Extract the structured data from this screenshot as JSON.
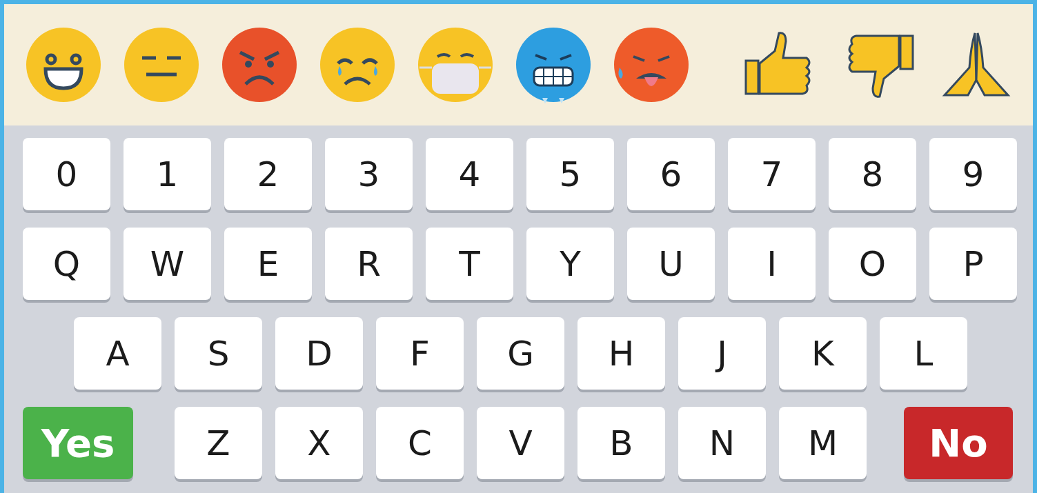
{
  "key_rows": [
    [
      {
        "label": "0",
        "kind": "char"
      },
      {
        "label": "1",
        "kind": "char"
      },
      {
        "label": "2",
        "kind": "char"
      },
      {
        "label": "3",
        "kind": "char"
      },
      {
        "label": "4",
        "kind": "char"
      },
      {
        "label": "5",
        "kind": "char"
      },
      {
        "label": "6",
        "kind": "char"
      },
      {
        "label": "7",
        "kind": "char"
      },
      {
        "label": "8",
        "kind": "char"
      },
      {
        "label": "9",
        "kind": "char"
      }
    ],
    [
      {
        "label": "Q",
        "kind": "char"
      },
      {
        "label": "W",
        "kind": "char"
      },
      {
        "label": "E",
        "kind": "char"
      },
      {
        "label": "R",
        "kind": "char"
      },
      {
        "label": "T",
        "kind": "char"
      },
      {
        "label": "Y",
        "kind": "char"
      },
      {
        "label": "U",
        "kind": "char"
      },
      {
        "label": "I",
        "kind": "char"
      },
      {
        "label": "O",
        "kind": "char"
      },
      {
        "label": "P",
        "kind": "char"
      }
    ],
    [
      {
        "label": "A",
        "kind": "char"
      },
      {
        "label": "S",
        "kind": "char"
      },
      {
        "label": "D",
        "kind": "char"
      },
      {
        "label": "F",
        "kind": "char"
      },
      {
        "label": "G",
        "kind": "char"
      },
      {
        "label": "H",
        "kind": "char"
      },
      {
        "label": "J",
        "kind": "char"
      },
      {
        "label": "K",
        "kind": "char"
      },
      {
        "label": "L",
        "kind": "char"
      }
    ],
    [
      {
        "label": "Yes",
        "kind": "accept"
      },
      {
        "label": "Z",
        "kind": "char"
      },
      {
        "label": "X",
        "kind": "char"
      },
      {
        "label": "C",
        "kind": "char"
      },
      {
        "label": "V",
        "kind": "char"
      },
      {
        "label": "B",
        "kind": "char"
      },
      {
        "label": "N",
        "kind": "char"
      },
      {
        "label": "M",
        "kind": "char"
      },
      {
        "label": "No",
        "kind": "decline"
      }
    ]
  ]
}
